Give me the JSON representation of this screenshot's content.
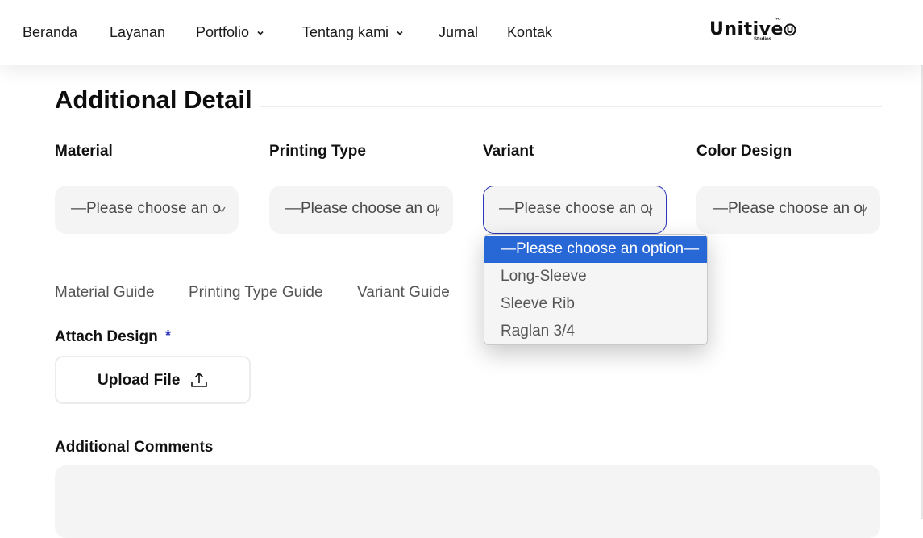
{
  "nav": {
    "items": [
      {
        "label": "Beranda",
        "dropdown": false
      },
      {
        "label": "Layanan",
        "dropdown": false
      },
      {
        "label": "Portfolio",
        "dropdown": true
      },
      {
        "label": "Tentang kami",
        "dropdown": true
      },
      {
        "label": "Jurnal",
        "dropdown": false
      },
      {
        "label": "Kontak",
        "dropdown": false
      }
    ],
    "logo": {
      "word": "Unitive",
      "tm": "™",
      "sub": "Studios."
    }
  },
  "form": {
    "section_title": "Additional Detail",
    "fields": [
      {
        "label": "Material",
        "value": "—Please choose an option—"
      },
      {
        "label": "Printing Type",
        "value": "—Please choose an option—"
      },
      {
        "label": "Variant",
        "value": "—Please choose an option—"
      },
      {
        "label": "Color Design",
        "value": "—Please choose an option—"
      }
    ],
    "variant_options": [
      "—Please choose an option—",
      "Long-Sleeve",
      "Sleeve Rib",
      "Raglan 3/4"
    ],
    "guides": [
      "Material Guide",
      "Printing Type Guide",
      "Variant Guide"
    ],
    "attach_label": "Attach Design",
    "required_mark": "*",
    "upload_label": "Upload File",
    "comments_label": "Additional Comments"
  },
  "colors": {
    "accent": "#2c36b8",
    "highlight": "#2767d6",
    "field_bg": "#f4f4f4"
  }
}
